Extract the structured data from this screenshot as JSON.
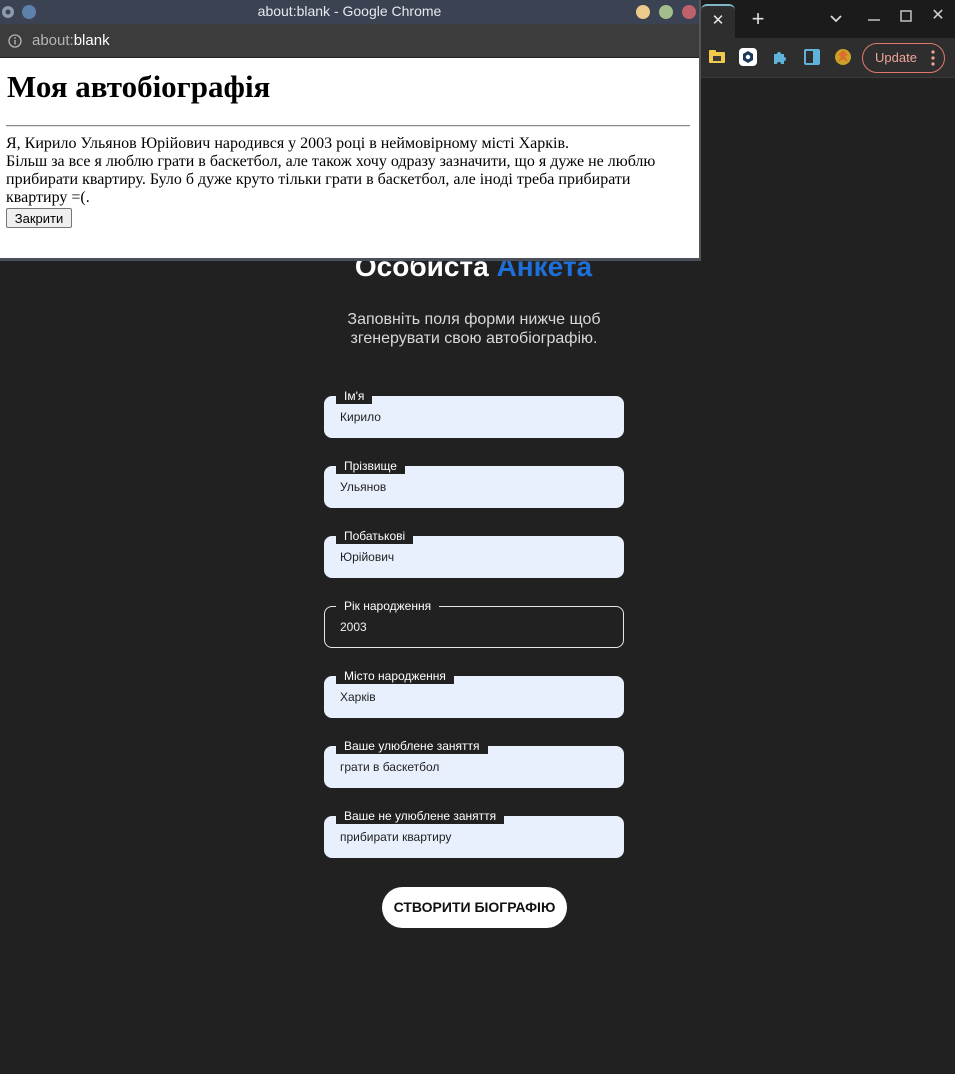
{
  "main_browser": {
    "tab_close": "✕",
    "new_tab": "+",
    "window_close": "✕",
    "update_label": "Update"
  },
  "page": {
    "heading_main": "Особиста",
    "heading_accent": "Анкета",
    "subtitle": "Заповніть поля форми нижче щоб згенерувати свою автобіографію.",
    "fields": [
      {
        "label": "Ім'я",
        "value": "Кирило"
      },
      {
        "label": "Прізвище",
        "value": "Ульянов"
      },
      {
        "label": "Побатькові",
        "value": "Юрійович"
      },
      {
        "label": "Рік народження",
        "value": "2003"
      },
      {
        "label": "Місто народження",
        "value": "Харків"
      },
      {
        "label": "Ваше улюблене заняття",
        "value": "грати в баскетбол"
      },
      {
        "label": "Ваше не улюблене заняття",
        "value": "прибирати квартиру"
      }
    ],
    "create_button": "СТВОРИТИ БІОГРАФІЮ"
  },
  "popup": {
    "window_title": "about:blank - Google Chrome",
    "url_scheme": "about:",
    "url_path": "blank",
    "bio_title": "Моя автобіографія",
    "bio_line1": "Я, Кирило Ульянов Юрійович народився у 2003 році в неймовірному місті Харків.",
    "bio_line2": "Більш за все я люблю грати в баскетбол, але також хочу одразу зазначити, що я дуже не люблю прибирати квартиру. Було б дуже круто тільки грати в баскетбол, але іноді треба прибирати квартиру =(.",
    "close_button": "Закрити"
  },
  "colors": {
    "background": "#212121",
    "accent": "#1f6fd8",
    "field_fill": "#e8f0fe",
    "update_border": "#e07a6e"
  }
}
